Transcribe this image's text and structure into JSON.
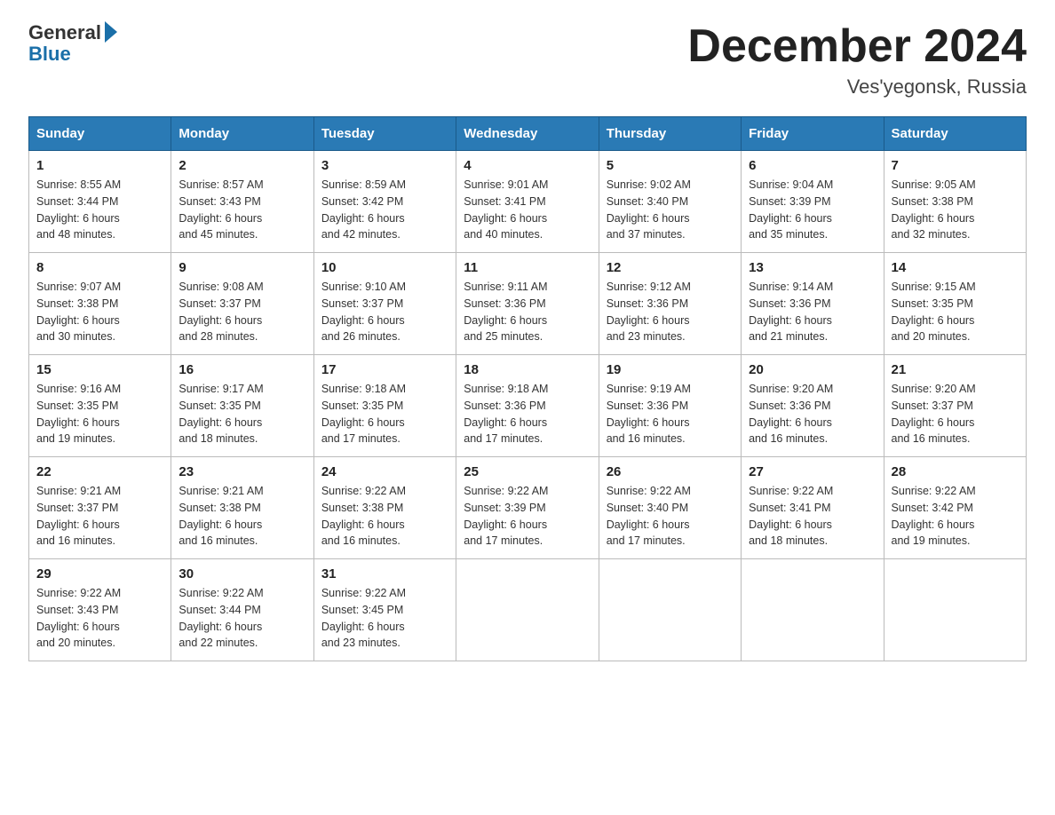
{
  "header": {
    "logo_general": "General",
    "logo_blue": "Blue",
    "month_title": "December 2024",
    "location": "Ves'yegonsk, Russia"
  },
  "days_of_week": [
    "Sunday",
    "Monday",
    "Tuesday",
    "Wednesday",
    "Thursday",
    "Friday",
    "Saturday"
  ],
  "weeks": [
    [
      {
        "day": "1",
        "sunrise": "8:55 AM",
        "sunset": "3:44 PM",
        "daylight": "6 hours and 48 minutes."
      },
      {
        "day": "2",
        "sunrise": "8:57 AM",
        "sunset": "3:43 PM",
        "daylight": "6 hours and 45 minutes."
      },
      {
        "day": "3",
        "sunrise": "8:59 AM",
        "sunset": "3:42 PM",
        "daylight": "6 hours and 42 minutes."
      },
      {
        "day": "4",
        "sunrise": "9:01 AM",
        "sunset": "3:41 PM",
        "daylight": "6 hours and 40 minutes."
      },
      {
        "day": "5",
        "sunrise": "9:02 AM",
        "sunset": "3:40 PM",
        "daylight": "6 hours and 37 minutes."
      },
      {
        "day": "6",
        "sunrise": "9:04 AM",
        "sunset": "3:39 PM",
        "daylight": "6 hours and 35 minutes."
      },
      {
        "day": "7",
        "sunrise": "9:05 AM",
        "sunset": "3:38 PM",
        "daylight": "6 hours and 32 minutes."
      }
    ],
    [
      {
        "day": "8",
        "sunrise": "9:07 AM",
        "sunset": "3:38 PM",
        "daylight": "6 hours and 30 minutes."
      },
      {
        "day": "9",
        "sunrise": "9:08 AM",
        "sunset": "3:37 PM",
        "daylight": "6 hours and 28 minutes."
      },
      {
        "day": "10",
        "sunrise": "9:10 AM",
        "sunset": "3:37 PM",
        "daylight": "6 hours and 26 minutes."
      },
      {
        "day": "11",
        "sunrise": "9:11 AM",
        "sunset": "3:36 PM",
        "daylight": "6 hours and 25 minutes."
      },
      {
        "day": "12",
        "sunrise": "9:12 AM",
        "sunset": "3:36 PM",
        "daylight": "6 hours and 23 minutes."
      },
      {
        "day": "13",
        "sunrise": "9:14 AM",
        "sunset": "3:36 PM",
        "daylight": "6 hours and 21 minutes."
      },
      {
        "day": "14",
        "sunrise": "9:15 AM",
        "sunset": "3:35 PM",
        "daylight": "6 hours and 20 minutes."
      }
    ],
    [
      {
        "day": "15",
        "sunrise": "9:16 AM",
        "sunset": "3:35 PM",
        "daylight": "6 hours and 19 minutes."
      },
      {
        "day": "16",
        "sunrise": "9:17 AM",
        "sunset": "3:35 PM",
        "daylight": "6 hours and 18 minutes."
      },
      {
        "day": "17",
        "sunrise": "9:18 AM",
        "sunset": "3:35 PM",
        "daylight": "6 hours and 17 minutes."
      },
      {
        "day": "18",
        "sunrise": "9:18 AM",
        "sunset": "3:36 PM",
        "daylight": "6 hours and 17 minutes."
      },
      {
        "day": "19",
        "sunrise": "9:19 AM",
        "sunset": "3:36 PM",
        "daylight": "6 hours and 16 minutes."
      },
      {
        "day": "20",
        "sunrise": "9:20 AM",
        "sunset": "3:36 PM",
        "daylight": "6 hours and 16 minutes."
      },
      {
        "day": "21",
        "sunrise": "9:20 AM",
        "sunset": "3:37 PM",
        "daylight": "6 hours and 16 minutes."
      }
    ],
    [
      {
        "day": "22",
        "sunrise": "9:21 AM",
        "sunset": "3:37 PM",
        "daylight": "6 hours and 16 minutes."
      },
      {
        "day": "23",
        "sunrise": "9:21 AM",
        "sunset": "3:38 PM",
        "daylight": "6 hours and 16 minutes."
      },
      {
        "day": "24",
        "sunrise": "9:22 AM",
        "sunset": "3:38 PM",
        "daylight": "6 hours and 16 minutes."
      },
      {
        "day": "25",
        "sunrise": "9:22 AM",
        "sunset": "3:39 PM",
        "daylight": "6 hours and 17 minutes."
      },
      {
        "day": "26",
        "sunrise": "9:22 AM",
        "sunset": "3:40 PM",
        "daylight": "6 hours and 17 minutes."
      },
      {
        "day": "27",
        "sunrise": "9:22 AM",
        "sunset": "3:41 PM",
        "daylight": "6 hours and 18 minutes."
      },
      {
        "day": "28",
        "sunrise": "9:22 AM",
        "sunset": "3:42 PM",
        "daylight": "6 hours and 19 minutes."
      }
    ],
    [
      {
        "day": "29",
        "sunrise": "9:22 AM",
        "sunset": "3:43 PM",
        "daylight": "6 hours and 20 minutes."
      },
      {
        "day": "30",
        "sunrise": "9:22 AM",
        "sunset": "3:44 PM",
        "daylight": "6 hours and 22 minutes."
      },
      {
        "day": "31",
        "sunrise": "9:22 AM",
        "sunset": "3:45 PM",
        "daylight": "6 hours and 23 minutes."
      },
      null,
      null,
      null,
      null
    ]
  ],
  "labels": {
    "sunrise": "Sunrise:",
    "sunset": "Sunset:",
    "daylight": "Daylight:"
  }
}
